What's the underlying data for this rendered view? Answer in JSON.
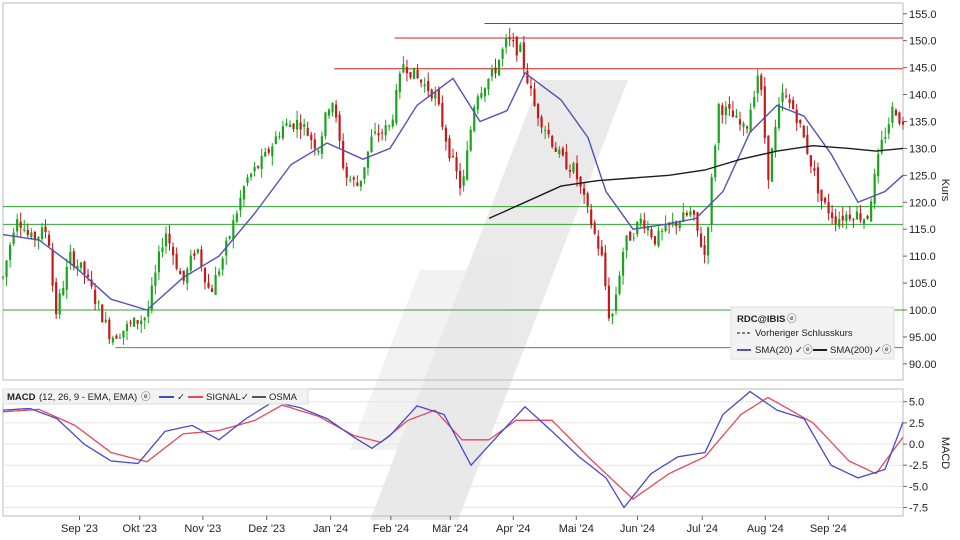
{
  "chart_data": {
    "type": "candlestick",
    "price_panel": {
      "ylabel": "Kurs",
      "ylim": [
        87,
        157
      ],
      "yticks": [
        90,
        95,
        100,
        105,
        110,
        115,
        120,
        125,
        130,
        135,
        140,
        145,
        150,
        155
      ],
      "ytick_labels": [
        "90.00",
        "95.00",
        "100.0",
        "105.0",
        "110.0",
        "115.0",
        "120.0",
        "125.0",
        "130.0",
        "135.0",
        "140.0",
        "145.0",
        "150.0",
        "155.0"
      ],
      "resistance_lines": [
        {
          "value": 153.2,
          "from": 0.535
        },
        {
          "value": 150.5,
          "from": 0.435
        },
        {
          "value": 144.8,
          "from": 0.368
        }
      ],
      "support_lines": [
        {
          "value": 119.2,
          "from": 0.0
        },
        {
          "value": 115.9,
          "from": 0.0
        },
        {
          "value": 100.0,
          "from": 0.0
        },
        {
          "value": 93.0,
          "from": 0.125
        }
      ],
      "legend": {
        "title": "RDC@IBIS",
        "prev_close": "Vorheriger Schlusskurs",
        "sma20": "SMA(20)",
        "sma200": "SMA(200)"
      },
      "ohlc_anchors": [
        {
          "t": 0.0,
          "v": 106
        },
        {
          "t": 0.015,
          "v": 118
        },
        {
          "t": 0.03,
          "v": 113
        },
        {
          "t": 0.05,
          "v": 115
        },
        {
          "t": 0.058,
          "v": 99
        },
        {
          "t": 0.075,
          "v": 110
        },
        {
          "t": 0.09,
          "v": 107
        },
        {
          "t": 0.12,
          "v": 95
        },
        {
          "t": 0.14,
          "v": 97
        },
        {
          "t": 0.16,
          "v": 99
        },
        {
          "t": 0.18,
          "v": 115
        },
        {
          "t": 0.2,
          "v": 105
        },
        {
          "t": 0.215,
          "v": 112
        },
        {
          "t": 0.23,
          "v": 103
        },
        {
          "t": 0.245,
          "v": 110
        },
        {
          "t": 0.27,
          "v": 124
        },
        {
          "t": 0.29,
          "v": 128
        },
        {
          "t": 0.31,
          "v": 134
        },
        {
          "t": 0.33,
          "v": 135
        },
        {
          "t": 0.35,
          "v": 130
        },
        {
          "t": 0.365,
          "v": 140
        },
        {
          "t": 0.38,
          "v": 125
        },
        {
          "t": 0.395,
          "v": 123
        },
        {
          "t": 0.41,
          "v": 132
        },
        {
          "t": 0.43,
          "v": 134
        },
        {
          "t": 0.445,
          "v": 146
        },
        {
          "t": 0.46,
          "v": 143
        },
        {
          "t": 0.48,
          "v": 140
        },
        {
          "t": 0.495,
          "v": 130
        },
        {
          "t": 0.51,
          "v": 122
        },
        {
          "t": 0.525,
          "v": 140
        },
        {
          "t": 0.545,
          "v": 144
        },
        {
          "t": 0.56,
          "v": 150
        },
        {
          "t": 0.575,
          "v": 148
        },
        {
          "t": 0.59,
          "v": 138
        },
        {
          "t": 0.605,
          "v": 133
        },
        {
          "t": 0.62,
          "v": 128
        },
        {
          "t": 0.635,
          "v": 126
        },
        {
          "t": 0.65,
          "v": 118
        },
        {
          "t": 0.665,
          "v": 110
        },
        {
          "t": 0.675,
          "v": 97
        },
        {
          "t": 0.69,
          "v": 112
        },
        {
          "t": 0.71,
          "v": 117
        },
        {
          "t": 0.725,
          "v": 113
        },
        {
          "t": 0.745,
          "v": 116
        },
        {
          "t": 0.765,
          "v": 118
        },
        {
          "t": 0.78,
          "v": 110
        },
        {
          "t": 0.795,
          "v": 138
        },
        {
          "t": 0.81,
          "v": 136
        },
        {
          "t": 0.825,
          "v": 133
        },
        {
          "t": 0.84,
          "v": 145
        },
        {
          "t": 0.85,
          "v": 125
        },
        {
          "t": 0.865,
          "v": 140
        },
        {
          "t": 0.88,
          "v": 137
        },
        {
          "t": 0.895,
          "v": 129
        },
        {
          "t": 0.91,
          "v": 120
        },
        {
          "t": 0.925,
          "v": 117
        },
        {
          "t": 0.945,
          "v": 118
        },
        {
          "t": 0.96,
          "v": 117
        },
        {
          "t": 0.975,
          "v": 130
        },
        {
          "t": 0.99,
          "v": 138
        },
        {
          "t": 1.0,
          "v": 134
        }
      ],
      "sma20": [
        {
          "t": 0.0,
          "v": 114
        },
        {
          "t": 0.04,
          "v": 113
        },
        {
          "t": 0.08,
          "v": 108
        },
        {
          "t": 0.12,
          "v": 102
        },
        {
          "t": 0.16,
          "v": 100
        },
        {
          "t": 0.2,
          "v": 106
        },
        {
          "t": 0.24,
          "v": 110
        },
        {
          "t": 0.28,
          "v": 118
        },
        {
          "t": 0.32,
          "v": 127
        },
        {
          "t": 0.36,
          "v": 131
        },
        {
          "t": 0.4,
          "v": 128
        },
        {
          "t": 0.43,
          "v": 130
        },
        {
          "t": 0.46,
          "v": 138
        },
        {
          "t": 0.5,
          "v": 143
        },
        {
          "t": 0.53,
          "v": 135
        },
        {
          "t": 0.56,
          "v": 137
        },
        {
          "t": 0.58,
          "v": 144
        },
        {
          "t": 0.62,
          "v": 139
        },
        {
          "t": 0.65,
          "v": 132
        },
        {
          "t": 0.67,
          "v": 122
        },
        {
          "t": 0.7,
          "v": 115
        },
        {
          "t": 0.74,
          "v": 116
        },
        {
          "t": 0.77,
          "v": 117
        },
        {
          "t": 0.8,
          "v": 122
        },
        {
          "t": 0.83,
          "v": 133
        },
        {
          "t": 0.86,
          "v": 138
        },
        {
          "t": 0.89,
          "v": 136
        },
        {
          "t": 0.92,
          "v": 129
        },
        {
          "t": 0.95,
          "v": 120
        },
        {
          "t": 0.98,
          "v": 122
        },
        {
          "t": 1.0,
          "v": 125
        }
      ],
      "sma200": [
        {
          "t": 0.54,
          "v": 117
        },
        {
          "t": 0.58,
          "v": 120
        },
        {
          "t": 0.62,
          "v": 123
        },
        {
          "t": 0.66,
          "v": 124
        },
        {
          "t": 0.7,
          "v": 124.5
        },
        {
          "t": 0.74,
          "v": 125
        },
        {
          "t": 0.78,
          "v": 126
        },
        {
          "t": 0.82,
          "v": 128
        },
        {
          "t": 0.86,
          "v": 129.5
        },
        {
          "t": 0.9,
          "v": 130.5
        },
        {
          "t": 0.94,
          "v": 130
        },
        {
          "t": 0.97,
          "v": 129.5
        },
        {
          "t": 1.0,
          "v": 130
        }
      ]
    },
    "macd_panel": {
      "ylabel": "MACD",
      "ylim": [
        -8.5,
        6.5
      ],
      "yticks": [
        5,
        2.5,
        0,
        -2.5,
        -5,
        -7.5
      ],
      "ytick_labels": [
        "5.0",
        "2.5",
        "0.0",
        "-2.5",
        "-5.0",
        "-7.5"
      ],
      "legend": {
        "title": "MACD",
        "params": "(12, 26, 9 - EMA, EMA)",
        "signal": "SIGNAL",
        "osma": "OSMA"
      },
      "macd": [
        {
          "t": 0.0,
          "v": 4
        },
        {
          "t": 0.03,
          "v": 4.2
        },
        {
          "t": 0.06,
          "v": 3
        },
        {
          "t": 0.09,
          "v": 0
        },
        {
          "t": 0.12,
          "v": -2
        },
        {
          "t": 0.15,
          "v": -2.3
        },
        {
          "t": 0.18,
          "v": 1.5
        },
        {
          "t": 0.21,
          "v": 2.2
        },
        {
          "t": 0.24,
          "v": 0.5
        },
        {
          "t": 0.27,
          "v": 3
        },
        {
          "t": 0.3,
          "v": 5
        },
        {
          "t": 0.33,
          "v": 4.3
        },
        {
          "t": 0.36,
          "v": 3
        },
        {
          "t": 0.39,
          "v": 0.8
        },
        {
          "t": 0.41,
          "v": -0.5
        },
        {
          "t": 0.43,
          "v": 1
        },
        {
          "t": 0.46,
          "v": 4.5
        },
        {
          "t": 0.49,
          "v": 3.5
        },
        {
          "t": 0.52,
          "v": -2.5
        },
        {
          "t": 0.55,
          "v": 1
        },
        {
          "t": 0.58,
          "v": 4.4
        },
        {
          "t": 0.61,
          "v": 1.5
        },
        {
          "t": 0.64,
          "v": -1.5
        },
        {
          "t": 0.67,
          "v": -4
        },
        {
          "t": 0.69,
          "v": -7.5
        },
        {
          "t": 0.72,
          "v": -3.5
        },
        {
          "t": 0.75,
          "v": -1.5
        },
        {
          "t": 0.78,
          "v": -1
        },
        {
          "t": 0.8,
          "v": 3.5
        },
        {
          "t": 0.83,
          "v": 6.2
        },
        {
          "t": 0.86,
          "v": 4
        },
        {
          "t": 0.89,
          "v": 3
        },
        {
          "t": 0.92,
          "v": -2.5
        },
        {
          "t": 0.95,
          "v": -4
        },
        {
          "t": 0.98,
          "v": -3
        },
        {
          "t": 1.0,
          "v": 2.6
        }
      ],
      "signal": [
        {
          "t": 0.0,
          "v": 3.8
        },
        {
          "t": 0.04,
          "v": 4.1
        },
        {
          "t": 0.08,
          "v": 2.2
        },
        {
          "t": 0.12,
          "v": -1
        },
        {
          "t": 0.16,
          "v": -2.1
        },
        {
          "t": 0.2,
          "v": 1.2
        },
        {
          "t": 0.24,
          "v": 1.6
        },
        {
          "t": 0.28,
          "v": 2.8
        },
        {
          "t": 0.31,
          "v": 4.6
        },
        {
          "t": 0.35,
          "v": 3.3
        },
        {
          "t": 0.39,
          "v": 1
        },
        {
          "t": 0.42,
          "v": 0.2
        },
        {
          "t": 0.45,
          "v": 2.8
        },
        {
          "t": 0.48,
          "v": 4
        },
        {
          "t": 0.51,
          "v": 0.5
        },
        {
          "t": 0.54,
          "v": 0.5
        },
        {
          "t": 0.57,
          "v": 2.8
        },
        {
          "t": 0.61,
          "v": 2.8
        },
        {
          "t": 0.65,
          "v": -1.5
        },
        {
          "t": 0.7,
          "v": -6.5
        },
        {
          "t": 0.74,
          "v": -3.5
        },
        {
          "t": 0.78,
          "v": -1.5
        },
        {
          "t": 0.82,
          "v": 3.5
        },
        {
          "t": 0.85,
          "v": 5.5
        },
        {
          "t": 0.9,
          "v": 2.5
        },
        {
          "t": 0.94,
          "v": -2
        },
        {
          "t": 0.97,
          "v": -3.5
        },
        {
          "t": 1.0,
          "v": 0.8
        }
      ]
    },
    "x_axis": {
      "labels": [
        "Sep '23",
        "Okt '23",
        "Nov '23",
        "Dez '23",
        "Jan '24",
        "Feb '24",
        "Mär '24",
        "Apr '24",
        "Mai '24",
        "Jun '24",
        "Jul '24",
        "Aug '24",
        "Sep '24"
      ],
      "positions": [
        0.085,
        0.152,
        0.222,
        0.293,
        0.364,
        0.431,
        0.497,
        0.567,
        0.637,
        0.705,
        0.777,
        0.847,
        0.917
      ]
    },
    "colors": {
      "up": "#19a41d",
      "down": "#c41a1a",
      "sma20": "#5650b8",
      "sma200": "#1c1c1c",
      "macd": "#4848cc",
      "signal": "#e8485a",
      "resistance": "#d62020",
      "support": "#2fa52f"
    }
  }
}
